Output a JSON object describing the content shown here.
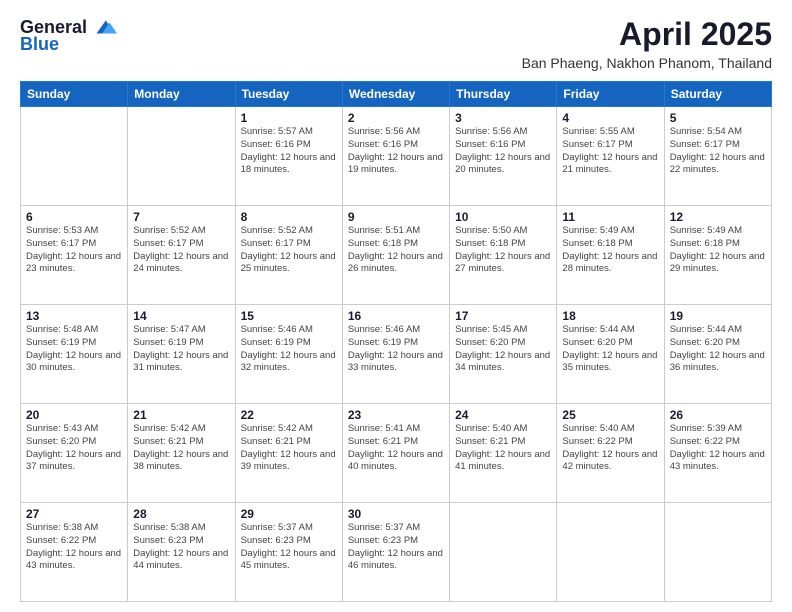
{
  "logo": {
    "text_general": "General",
    "text_blue": "Blue"
  },
  "header": {
    "month_title": "April 2025",
    "location": "Ban Phaeng, Nakhon Phanom, Thailand"
  },
  "weekdays": [
    "Sunday",
    "Monday",
    "Tuesday",
    "Wednesday",
    "Thursday",
    "Friday",
    "Saturday"
  ],
  "weeks": [
    [
      {
        "day": "",
        "info": ""
      },
      {
        "day": "",
        "info": ""
      },
      {
        "day": "1",
        "info": "Sunrise: 5:57 AM\nSunset: 6:16 PM\nDaylight: 12 hours and 18 minutes."
      },
      {
        "day": "2",
        "info": "Sunrise: 5:56 AM\nSunset: 6:16 PM\nDaylight: 12 hours and 19 minutes."
      },
      {
        "day": "3",
        "info": "Sunrise: 5:56 AM\nSunset: 6:16 PM\nDaylight: 12 hours and 20 minutes."
      },
      {
        "day": "4",
        "info": "Sunrise: 5:55 AM\nSunset: 6:17 PM\nDaylight: 12 hours and 21 minutes."
      },
      {
        "day": "5",
        "info": "Sunrise: 5:54 AM\nSunset: 6:17 PM\nDaylight: 12 hours and 22 minutes."
      }
    ],
    [
      {
        "day": "6",
        "info": "Sunrise: 5:53 AM\nSunset: 6:17 PM\nDaylight: 12 hours and 23 minutes."
      },
      {
        "day": "7",
        "info": "Sunrise: 5:52 AM\nSunset: 6:17 PM\nDaylight: 12 hours and 24 minutes."
      },
      {
        "day": "8",
        "info": "Sunrise: 5:52 AM\nSunset: 6:17 PM\nDaylight: 12 hours and 25 minutes."
      },
      {
        "day": "9",
        "info": "Sunrise: 5:51 AM\nSunset: 6:18 PM\nDaylight: 12 hours and 26 minutes."
      },
      {
        "day": "10",
        "info": "Sunrise: 5:50 AM\nSunset: 6:18 PM\nDaylight: 12 hours and 27 minutes."
      },
      {
        "day": "11",
        "info": "Sunrise: 5:49 AM\nSunset: 6:18 PM\nDaylight: 12 hours and 28 minutes."
      },
      {
        "day": "12",
        "info": "Sunrise: 5:49 AM\nSunset: 6:18 PM\nDaylight: 12 hours and 29 minutes."
      }
    ],
    [
      {
        "day": "13",
        "info": "Sunrise: 5:48 AM\nSunset: 6:19 PM\nDaylight: 12 hours and 30 minutes."
      },
      {
        "day": "14",
        "info": "Sunrise: 5:47 AM\nSunset: 6:19 PM\nDaylight: 12 hours and 31 minutes."
      },
      {
        "day": "15",
        "info": "Sunrise: 5:46 AM\nSunset: 6:19 PM\nDaylight: 12 hours and 32 minutes."
      },
      {
        "day": "16",
        "info": "Sunrise: 5:46 AM\nSunset: 6:19 PM\nDaylight: 12 hours and 33 minutes."
      },
      {
        "day": "17",
        "info": "Sunrise: 5:45 AM\nSunset: 6:20 PM\nDaylight: 12 hours and 34 minutes."
      },
      {
        "day": "18",
        "info": "Sunrise: 5:44 AM\nSunset: 6:20 PM\nDaylight: 12 hours and 35 minutes."
      },
      {
        "day": "19",
        "info": "Sunrise: 5:44 AM\nSunset: 6:20 PM\nDaylight: 12 hours and 36 minutes."
      }
    ],
    [
      {
        "day": "20",
        "info": "Sunrise: 5:43 AM\nSunset: 6:20 PM\nDaylight: 12 hours and 37 minutes."
      },
      {
        "day": "21",
        "info": "Sunrise: 5:42 AM\nSunset: 6:21 PM\nDaylight: 12 hours and 38 minutes."
      },
      {
        "day": "22",
        "info": "Sunrise: 5:42 AM\nSunset: 6:21 PM\nDaylight: 12 hours and 39 minutes."
      },
      {
        "day": "23",
        "info": "Sunrise: 5:41 AM\nSunset: 6:21 PM\nDaylight: 12 hours and 40 minutes."
      },
      {
        "day": "24",
        "info": "Sunrise: 5:40 AM\nSunset: 6:21 PM\nDaylight: 12 hours and 41 minutes."
      },
      {
        "day": "25",
        "info": "Sunrise: 5:40 AM\nSunset: 6:22 PM\nDaylight: 12 hours and 42 minutes."
      },
      {
        "day": "26",
        "info": "Sunrise: 5:39 AM\nSunset: 6:22 PM\nDaylight: 12 hours and 43 minutes."
      }
    ],
    [
      {
        "day": "27",
        "info": "Sunrise: 5:38 AM\nSunset: 6:22 PM\nDaylight: 12 hours and 43 minutes."
      },
      {
        "day": "28",
        "info": "Sunrise: 5:38 AM\nSunset: 6:23 PM\nDaylight: 12 hours and 44 minutes."
      },
      {
        "day": "29",
        "info": "Sunrise: 5:37 AM\nSunset: 6:23 PM\nDaylight: 12 hours and 45 minutes."
      },
      {
        "day": "30",
        "info": "Sunrise: 5:37 AM\nSunset: 6:23 PM\nDaylight: 12 hours and 46 minutes."
      },
      {
        "day": "",
        "info": ""
      },
      {
        "day": "",
        "info": ""
      },
      {
        "day": "",
        "info": ""
      }
    ]
  ]
}
